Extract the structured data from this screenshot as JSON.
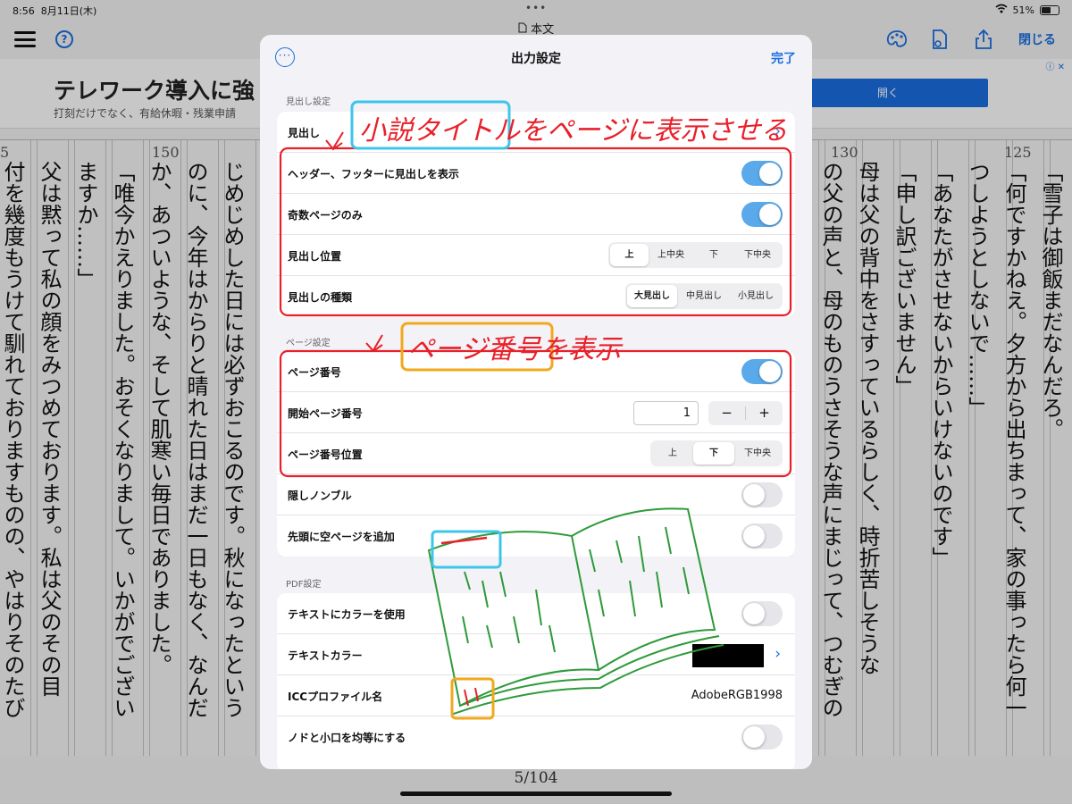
{
  "status_bar": {
    "time": "8:56",
    "date": "8月11日(木)",
    "battery": "51%"
  },
  "document": {
    "title": "本文",
    "page_counter": "5/104"
  },
  "toolbar": {
    "close_label": "閉じる"
  },
  "ad": {
    "title": "テレワーク導入に強",
    "subtitle": "打刻だけでなく、有給休暇・残業申請",
    "button_label": "開く"
  },
  "ruler": [
    "5",
    "150",
    "130",
    "125"
  ],
  "text_columns": [
    "「雪子は御飯まだなんだろ。",
    "「何ですかねえ。夕方から出ちまって、家の事ったら何一",
    "つしようとしないで……」",
    "「あなたがさせないからいけないのです」",
    "「申し訳ございません」",
    "母は父の背中をさすっているらしく、時折苦しそうな",
    "の父の声と、母のものうさそうな声にまじって、つむぎの",
    "じめじめした日には必ずおこるのです。秋になったという",
    "のに、今年はからりと晴れた日はまだ一日もなく、なんだ",
    "か、あついような、そして肌寒い毎日でありました。",
    "「唯今かえりました。おそくなりまして。いかがでござい",
    "ますか……」",
    "父は黙って私の顔をみつめております。私は父のその目",
    "付を幾度もうけて馴れておりますものの、やはりそのたび"
  ],
  "modal": {
    "title": "出力設定",
    "done_label": "完了",
    "heading_section": {
      "label": "見出し設定",
      "heading_row": "見出し",
      "show_in_header_footer": {
        "label": "ヘッダー、フッターに見出しを表示",
        "on": true
      },
      "odd_pages_only": {
        "label": "奇数ページのみ",
        "on": true
      },
      "heading_position": {
        "label": "見出し位置",
        "options": [
          "上",
          "上中央",
          "下",
          "下中央"
        ],
        "selected": "上"
      },
      "heading_type": {
        "label": "見出しの種類",
        "options": [
          "大見出し",
          "中見出し",
          "小見出し"
        ],
        "selected": "大見出し"
      }
    },
    "page_section": {
      "label": "ページ設定",
      "page_number": {
        "label": "ページ番号",
        "on": true
      },
      "start_page": {
        "label": "開始ページ番号",
        "value": "1",
        "minus": "−",
        "plus": "+"
      },
      "page_number_position": {
        "label": "ページ番号位置",
        "options": [
          "上",
          "下",
          "下中央"
        ],
        "selected": "下"
      },
      "hidden_nombre": {
        "label": "隠しノンブル",
        "on": false
      },
      "blank_first_page": {
        "label": "先頭に空ページを追加",
        "on": false
      }
    },
    "pdf_section": {
      "label": "PDF設定",
      "use_text_color": {
        "label": "テキストにカラーを使用",
        "on": false
      },
      "text_color": {
        "label": "テキストカラー",
        "color": "#000000"
      },
      "icc_profile": {
        "label": "ICCプロファイル名",
        "value": "AdobeRGB1998"
      },
      "equalize_edges": {
        "label": "ノドと小口を均等にする",
        "on": false
      }
    }
  },
  "annotations": {
    "title_note": "小説タイトルをページに表示させる",
    "title_note_boxed": "小説",
    "page_note": "ページ番号を表示",
    "page_note_boxed": "ページ番号",
    "colors": {
      "red": "#e8202a",
      "blue": "#3ec5ea",
      "orange": "#f2a81c",
      "green": "#2e9a3a"
    }
  }
}
